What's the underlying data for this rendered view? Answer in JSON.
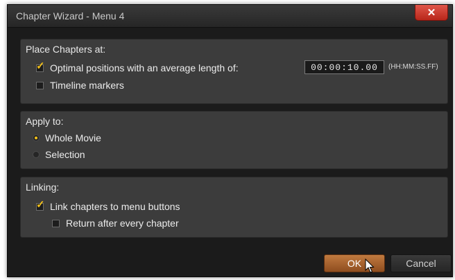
{
  "window": {
    "title": "Chapter Wizard - Menu 4",
    "close_glyph": "✕"
  },
  "place_chapters": {
    "heading": "Place Chapters at:",
    "optimal_label": "Optimal positions with an average length of:",
    "optimal_checked": true,
    "length_value": "00:00:10.00",
    "length_format": "(HH:MM:SS.FF)",
    "timeline_label": "Timeline markers",
    "timeline_checked": false
  },
  "apply_to": {
    "heading": "Apply to:",
    "options": [
      {
        "label": "Whole Movie",
        "selected": true
      },
      {
        "label": "Selection",
        "selected": false
      }
    ]
  },
  "linking": {
    "heading": "Linking:",
    "link_label": "Link chapters to menu buttons",
    "link_checked": true,
    "return_label": "Return after every chapter",
    "return_checked": false
  },
  "buttons": {
    "ok_label": "OK",
    "cancel_label": "Cancel"
  },
  "colors": {
    "accent": "#f2c019",
    "ok_button": "#b06a33",
    "close_button": "#c9372c"
  }
}
